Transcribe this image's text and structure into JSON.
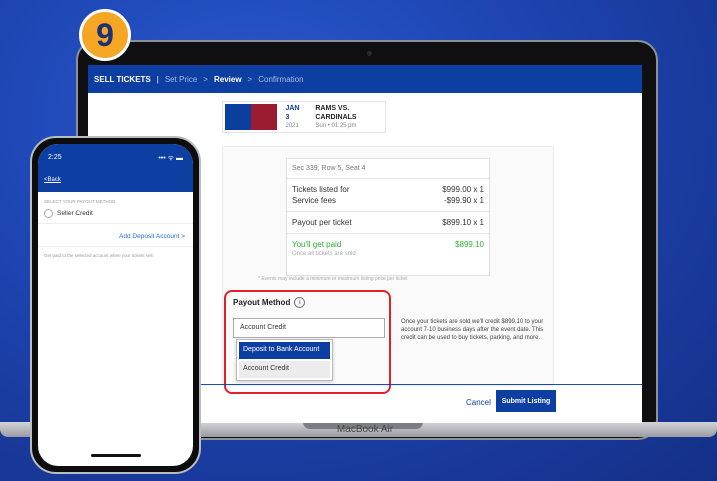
{
  "step_number": "9",
  "colors": {
    "brand": "#0d3fa3",
    "accent": "#f5a623",
    "highlight": "#e2202a",
    "success": "#2eae33"
  },
  "topbar": {
    "sell_tickets": "SELL TICKETS",
    "separator": "|",
    "set_price": "Set Price",
    "chev1": ">",
    "review": "Review",
    "chev2": ">",
    "confirmation": "Confirmation"
  },
  "event": {
    "date": "JAN 3",
    "year": "2021",
    "title": "RAMS VS. CARDINALS",
    "time": "Sun • 01:25 pm"
  },
  "summary": {
    "seat": "Sec 339, Row 5, Seat 4",
    "listed_label": "Tickets listed for",
    "listed_value": "$999.00 x 1",
    "fees_label": "Service fees",
    "fees_value": "-$99.90 x 1",
    "payout_label": "Payout per ticket",
    "payout_value": "$899.10 x 1",
    "paid_label": "You'll get paid",
    "paid_value": "$899.10",
    "sold_note": "Once all tickets are sold"
  },
  "disclaimer": "* Events may include a minimum or maximum listing price per ticket",
  "payout": {
    "title": "Payout Method",
    "info_icon": "i",
    "selected": "Account Credit",
    "options": [
      "Deposit to Bank Account",
      "Account Credit"
    ],
    "note": "Once your tickets are sold we'll credit $899.10 to your account 7-10 business days after the event date. This credit can be used to buy tickets, parking, and more."
  },
  "actions": {
    "cancel": "Cancel",
    "submit": "Submit Listing"
  },
  "laptop_label": "MacBook Air",
  "phone": {
    "time": "2:25",
    "status_icons": "••• ᯤ ▬",
    "back": "Back",
    "section": "SELECT YOUR PAYOUT METHOD",
    "option": "Seller Credit",
    "add": "Add Deposit Account",
    "add_chevron": ">",
    "note": "Get paid to the selected account when your tickets sell."
  }
}
